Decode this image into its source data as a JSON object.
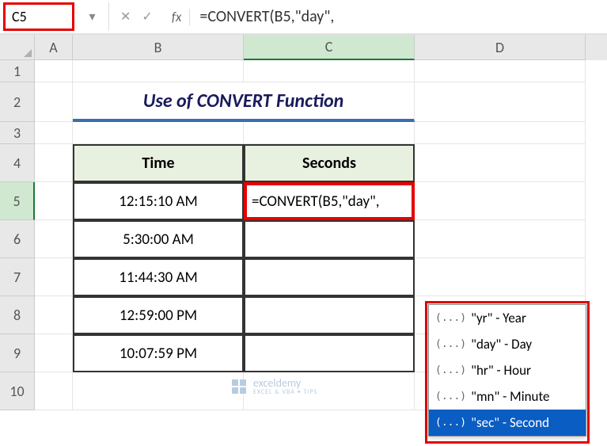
{
  "nameBox": "C5",
  "formulaBar": "=CONVERT(B5,\"day\",",
  "fxLabel": "fx",
  "columns": [
    "A",
    "B",
    "C",
    "D"
  ],
  "rows": [
    "1",
    "2",
    "3",
    "4",
    "5",
    "6",
    "7",
    "8",
    "9",
    "10"
  ],
  "title": "Use of CONVERT Function",
  "headers": {
    "time": "Time",
    "seconds": "Seconds"
  },
  "timeData": [
    "12:15:10 AM",
    "5:30:00 AM",
    "11:44:30 AM",
    "12:59:00 PM",
    "10:07:59 PM"
  ],
  "formulaCell": "=CONVERT(B5,\"day\",",
  "autocomplete": [
    {
      "label": "\"yr\" - Year",
      "selected": false
    },
    {
      "label": "\"day\" - Day",
      "selected": false
    },
    {
      "label": "\"hr\" - Hour",
      "selected": false
    },
    {
      "label": "\"mn\" - Minute",
      "selected": false
    },
    {
      "label": "\"sec\" - Second",
      "selected": true
    }
  ],
  "watermark": {
    "name": "exceldemy",
    "sub": "EXCEL & VBA • TIPS"
  }
}
